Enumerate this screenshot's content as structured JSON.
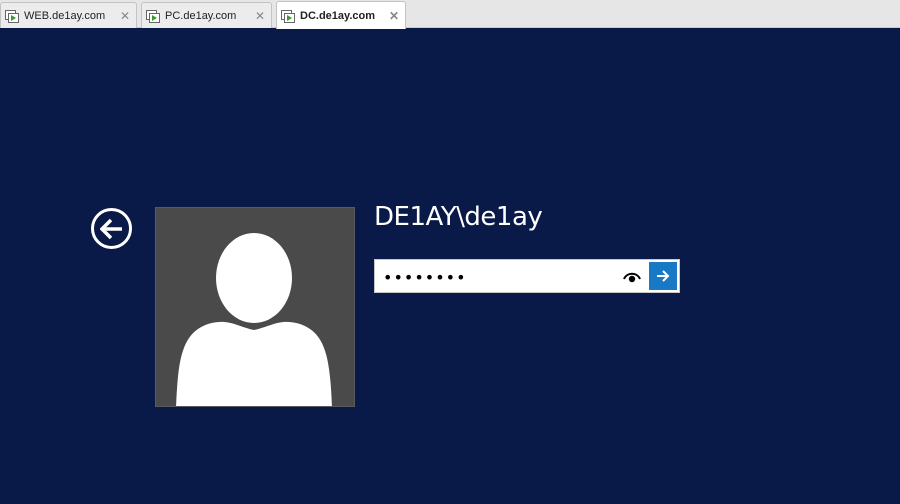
{
  "tabs": [
    {
      "label": "WEB.de1ay.com",
      "active": false,
      "icon": "vm-icon"
    },
    {
      "label": "PC.de1ay.com",
      "active": false,
      "icon": "vm-icon"
    },
    {
      "label": "DC.de1ay.com",
      "active": true,
      "icon": "vm-icon"
    }
  ],
  "tab_close_glyph": "✕",
  "login": {
    "username": "DE1AY\\de1ay",
    "password_value": "••••••••",
    "back_icon": "back-arrow-icon",
    "reveal_icon": "eye-icon",
    "submit_icon": "arrow-right-icon"
  },
  "colors": {
    "background": "#0a1a48",
    "accent": "#1979c4",
    "avatar_bg": "#4a4a4a"
  }
}
